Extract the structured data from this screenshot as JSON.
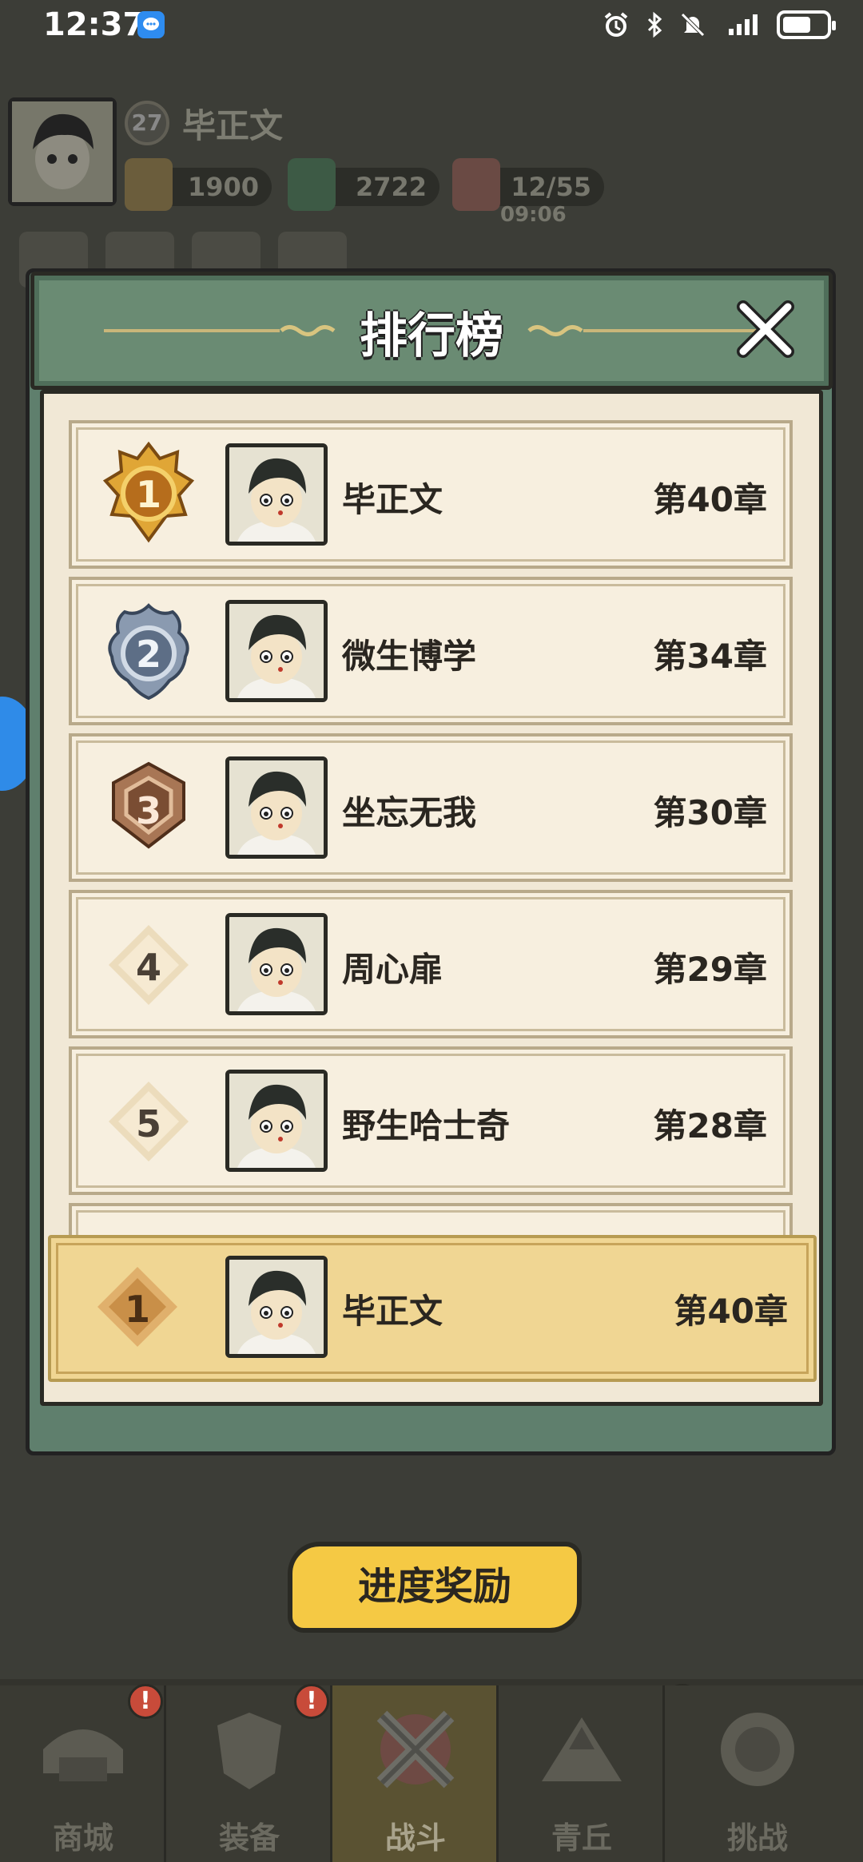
{
  "status_bar": {
    "time": "12:37",
    "icons": [
      "alarm-icon",
      "bluetooth-icon",
      "mute-icon",
      "signal-icon",
      "battery-icon"
    ]
  },
  "player": {
    "level": "27",
    "name": "毕正文",
    "gold": "1900",
    "jade": "2722",
    "stamina": "12/55",
    "stamina_timer": "09:06"
  },
  "leaderboard": {
    "title": "排行榜",
    "entries": [
      {
        "rank": "1",
        "name": "毕正文",
        "chapter": "第40章"
      },
      {
        "rank": "2",
        "name": "微生博学",
        "chapter": "第34章"
      },
      {
        "rank": "3",
        "name": "坐忘无我",
        "chapter": "第30章"
      },
      {
        "rank": "4",
        "name": "周心扉",
        "chapter": "第29章"
      },
      {
        "rank": "5",
        "name": "野生哈士奇",
        "chapter": "第28章"
      }
    ],
    "my_entry": {
      "rank": "1",
      "name": "毕正文",
      "chapter": "第40章"
    }
  },
  "progress_reward_label": "进度奖励",
  "nav": [
    {
      "label": "商城",
      "badge": "!"
    },
    {
      "label": "装备",
      "badge": "!"
    },
    {
      "label": "战斗",
      "badge": ""
    },
    {
      "label": "青丘",
      "badge": "!"
    },
    {
      "label": "挑战",
      "badge": ""
    }
  ],
  "colors": {
    "gold_badge": "#d59a2d",
    "silver_badge": "#7a8aa0",
    "bronze_badge": "#9a6a48",
    "highlight_row": "#f0d693",
    "modal_green": "#6a8b73",
    "reward_button": "#f5c944"
  }
}
